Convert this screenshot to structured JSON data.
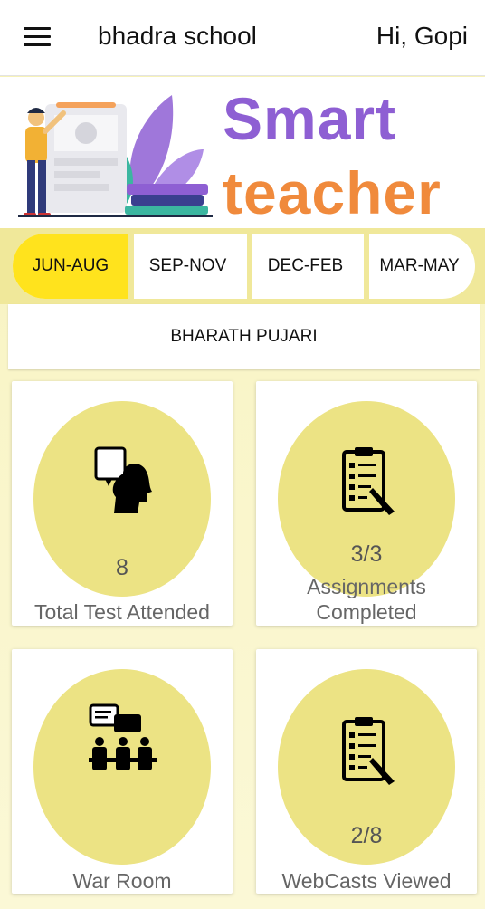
{
  "header": {
    "app_name": "bhadra school",
    "greeting": "Hi, Gopi"
  },
  "banner": {
    "line1": "Smart",
    "line2": "teacher"
  },
  "tabs": [
    {
      "label": "JUN-AUG",
      "active": true
    },
    {
      "label": "SEP-NOV",
      "active": false
    },
    {
      "label": "DEC-FEB",
      "active": false
    },
    {
      "label": "MAR-MAY",
      "active": false
    }
  ],
  "student_name": "BHARATH PUJARI",
  "cards": [
    {
      "value": "8",
      "label": "Total Test Attended",
      "icon": "head-speech-icon"
    },
    {
      "value": "3/3",
      "label_line1": "Assignments",
      "label_line2": "Completed",
      "icon": "clipboard-checklist-icon"
    },
    {
      "value": "",
      "label": "War Room",
      "icon": "meeting-room-icon"
    },
    {
      "value": "2/8",
      "label": "WebCasts Viewed",
      "icon": "clipboard-checklist-icon"
    }
  ],
  "colors": {
    "active_tab": "#ffe31d",
    "card_circle": "#ece384",
    "brand_purple": "#8e5fd3",
    "brand_orange": "#f08a3c"
  }
}
